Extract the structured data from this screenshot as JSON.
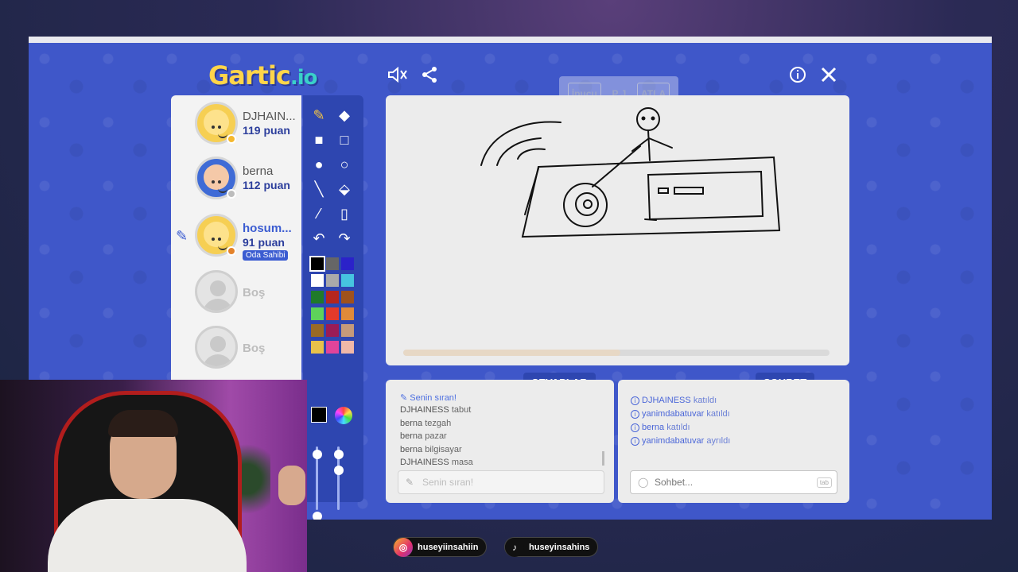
{
  "app": {
    "logo_main": "Gartic",
    "logo_suffix": ".io"
  },
  "hint_bar": {
    "hint": "İpucu",
    "letters": "P J",
    "skip": "ATLA"
  },
  "players": [
    {
      "name": "DJHAIN...",
      "score": "119 puan",
      "status_color": "#f5b82e"
    },
    {
      "name": "berna",
      "score": "112 puan",
      "status_color": "#bdbdbd"
    },
    {
      "name": "hosum...",
      "score": "91 puan",
      "status_color": "#e3822a",
      "badge": "Oda Sahibi"
    }
  ],
  "empty_slots": [
    {
      "label": "Boş"
    },
    {
      "label": "Boş"
    }
  ],
  "palette": {
    "colors": [
      "#000000",
      "#666666",
      "#2b22c9",
      "#ffffff",
      "#aaaaaa",
      "#46c5e0",
      "#1f7a2a",
      "#b5261e",
      "#a0521c",
      "#5ed35a",
      "#e33a2a",
      "#e08a3a",
      "#9a6a25",
      "#9a1c56",
      "#c59a7a",
      "#e8c14a",
      "#e0449a",
      "#f0b8a8"
    ],
    "selected": "#000000",
    "current_color": "#000000"
  },
  "canvas": {
    "progress_fraction": 0.51
  },
  "answers": {
    "tab_label": "CEVAPLAR",
    "turn_text": "Senin sıran!",
    "guesses": [
      {
        "user": "DJHAINESS",
        "word": "tabut"
      },
      {
        "user": "berna",
        "word": "tezgah"
      },
      {
        "user": "berna",
        "word": "pazar"
      },
      {
        "user": "berna",
        "word": "bilgisayar"
      },
      {
        "user": "DJHAINESS",
        "word": "masa"
      }
    ],
    "input_placeholder": "Senin sıran!"
  },
  "chat": {
    "tab_label": "SOHBET",
    "messages": [
      {
        "user": "DJHAINESS",
        "action": "katıldı"
      },
      {
        "user": "yanimdabatuvar",
        "action": "katıldı"
      },
      {
        "user": "berna",
        "action": "katıldı"
      },
      {
        "user": "yanimdabatuvar",
        "action": "ayrıldı"
      }
    ],
    "input_placeholder": "Sohbet...",
    "tab_hint": "tab"
  },
  "social": {
    "instagram": "huseyiinsahiin",
    "tiktok": "huseyinsahins"
  },
  "colors": {
    "frame_blue": "#3f57c9",
    "toolbar_blue": "#2e46b0",
    "accent": "#3b5cd1"
  }
}
